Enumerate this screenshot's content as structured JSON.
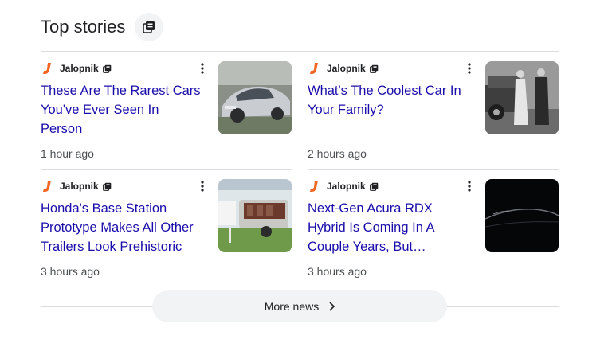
{
  "header": {
    "title": "Top stories"
  },
  "colors": {
    "headline": "#1a0dab",
    "source_logo": "#f26522",
    "divider": "#dadce0",
    "button_bg": "#f1f3f4"
  },
  "stories": [
    {
      "source": "Jalopnik",
      "headline": "These Are The Rarest Cars You've Ever Seen In Person",
      "time": "1 hour ago",
      "thumbnail": "silver-supercar-photo"
    },
    {
      "source": "Jalopnik",
      "headline": "What's The Coolest Car In Your Family?",
      "time": "2 hours ago",
      "thumbnail": "vintage-car-with-people-photo"
    },
    {
      "source": "Jalopnik",
      "headline": "Honda's Base Station Prototype Makes All Other Trailers Look Prehistoric",
      "time": "3 hours ago",
      "thumbnail": "trailer-on-grass-photo"
    },
    {
      "source": "Jalopnik",
      "headline": "Next-Gen Acura RDX Hybrid Is Coming In A Couple Years, But Production Of The...",
      "time": "3 hours ago",
      "thumbnail": "dark-suv-silhouette-photo"
    }
  ],
  "footer": {
    "more_label": "More news"
  },
  "icons": {
    "header": "news-stack-icon",
    "source_badge": "news-stack-icon",
    "menu": "three-dots-vertical-icon",
    "more": "chevron-right-icon",
    "source_logo": "jalopnik-j-logo"
  }
}
